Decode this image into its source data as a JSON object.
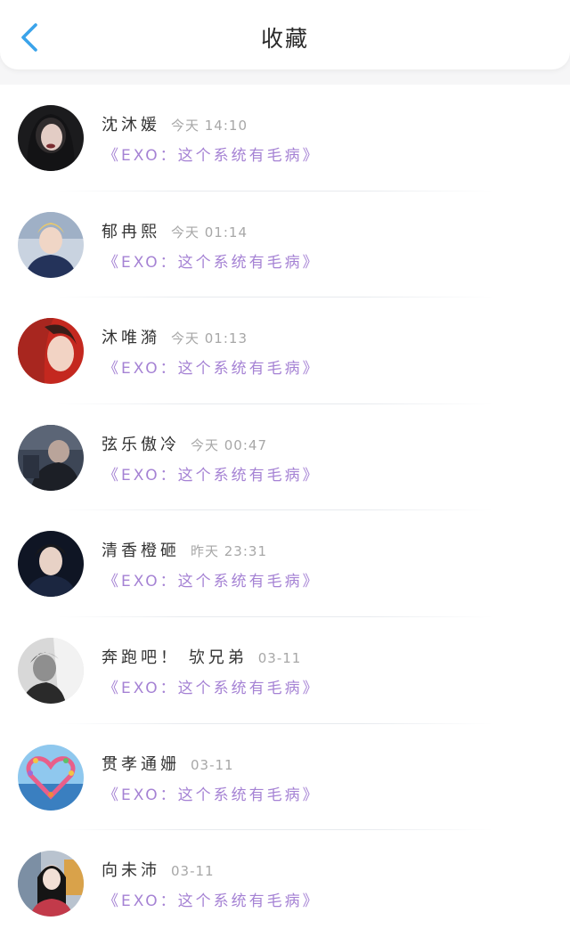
{
  "header": {
    "title": "收藏",
    "back_icon": "chevron-left-icon",
    "accent_color": "#3aa3ea"
  },
  "favorites": [
    {
      "name": "沈沐媛",
      "time": "今天 14:10",
      "book": "《EXO：这个系统有毛病》",
      "avatar_icon": "avatar-photo"
    },
    {
      "name": "郁冉熙",
      "time": "今天 01:14",
      "book": "《EXO：这个系统有毛病》",
      "avatar_icon": "avatar-photo"
    },
    {
      "name": "沐唯漪",
      "time": "今天 01:13",
      "book": "《EXO：这个系统有毛病》",
      "avatar_icon": "avatar-photo"
    },
    {
      "name": "弦乐傲冷",
      "time": "今天 00:47",
      "book": "《EXO：这个系统有毛病》",
      "avatar_icon": "avatar-photo"
    },
    {
      "name": "清香橙砸",
      "time": "昨天 23:31",
      "book": "《EXO：这个系统有毛病》",
      "avatar_icon": "avatar-photo"
    },
    {
      "name": "奔跑吧！ 欤兄弟",
      "time": "03-11",
      "book": "《EXO：这个系统有毛病》",
      "avatar_icon": "avatar-photo"
    },
    {
      "name": "贯孝通姗",
      "time": "03-11",
      "book": "《EXO：这个系统有毛病》",
      "avatar_icon": "heart-balloons-avatar"
    },
    {
      "name": "向未沛",
      "time": "03-11",
      "book": "《EXO：这个系统有毛病》",
      "avatar_icon": "avatar-photo"
    }
  ]
}
